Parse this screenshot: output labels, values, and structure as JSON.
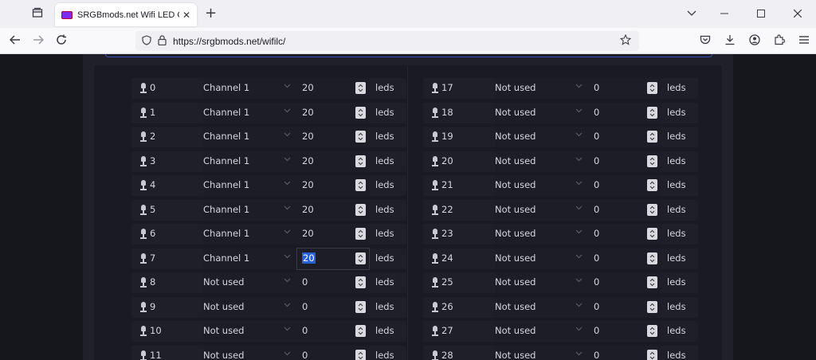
{
  "browser": {
    "tab_title": "SRGBmods.net Wifi LED Controller",
    "url_display": "https://srgbmods.net/wifilc/",
    "new_tab_glyph": "+",
    "close_glyph": "✕"
  },
  "page": {
    "unit_label": "leds",
    "selected_row": 7,
    "left_rows": [
      {
        "pin": "0",
        "channel": "Channel 1",
        "count": "20"
      },
      {
        "pin": "1",
        "channel": "Channel 1",
        "count": "20"
      },
      {
        "pin": "2",
        "channel": "Channel 1",
        "count": "20"
      },
      {
        "pin": "3",
        "channel": "Channel 1",
        "count": "20"
      },
      {
        "pin": "4",
        "channel": "Channel 1",
        "count": "20"
      },
      {
        "pin": "5",
        "channel": "Channel 1",
        "count": "20"
      },
      {
        "pin": "6",
        "channel": "Channel 1",
        "count": "20"
      },
      {
        "pin": "7",
        "channel": "Channel 1",
        "count": "20"
      },
      {
        "pin": "8",
        "channel": "Not used",
        "count": "0"
      },
      {
        "pin": "9",
        "channel": "Not used",
        "count": "0"
      },
      {
        "pin": "10",
        "channel": "Not used",
        "count": "0"
      },
      {
        "pin": "11",
        "channel": "Not used",
        "count": "0"
      }
    ],
    "right_rows": [
      {
        "pin": "17",
        "channel": "Not used",
        "count": "0"
      },
      {
        "pin": "18",
        "channel": "Not used",
        "count": "0"
      },
      {
        "pin": "19",
        "channel": "Not used",
        "count": "0"
      },
      {
        "pin": "20",
        "channel": "Not used",
        "count": "0"
      },
      {
        "pin": "21",
        "channel": "Not used",
        "count": "0"
      },
      {
        "pin": "22",
        "channel": "Not used",
        "count": "0"
      },
      {
        "pin": "23",
        "channel": "Not used",
        "count": "0"
      },
      {
        "pin": "24",
        "channel": "Not used",
        "count": "0"
      },
      {
        "pin": "25",
        "channel": "Not used",
        "count": "0"
      },
      {
        "pin": "26",
        "channel": "Not used",
        "count": "0"
      },
      {
        "pin": "27",
        "channel": "Not used",
        "count": "0"
      },
      {
        "pin": "28",
        "channel": "Not used",
        "count": "0"
      }
    ]
  },
  "colors": {
    "page_bg": "#16161d",
    "panel_bg": "#20202b",
    "row_bg": "#1f1f2a",
    "text": "#d6d6de",
    "selection": "#2660d6",
    "accent_border": "#3c4fb8"
  }
}
